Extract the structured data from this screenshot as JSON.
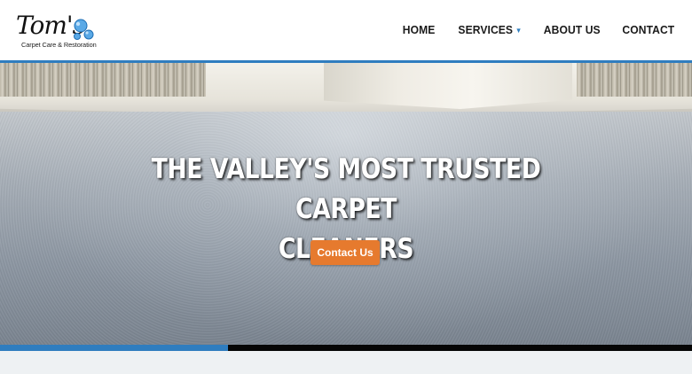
{
  "brand": {
    "logo_word": "Tom's",
    "logo_tagline": "Carpet Care & Restoration"
  },
  "nav": {
    "items": [
      {
        "label": "HOME"
      },
      {
        "label": "SERVICES",
        "has_dropdown": true
      },
      {
        "label": "ABOUT US"
      },
      {
        "label": "CONTACT"
      }
    ]
  },
  "hero": {
    "headline_line1": "THE VALLEY'S MOST TRUSTED CARPET",
    "headline_line2": "CLEANERS",
    "cta_label": "Contact Us",
    "slider_progress": 0.33
  },
  "colors": {
    "accent_blue": "#2f7dbf",
    "cta_orange": "#e67a2e",
    "nav_text": "#1a1a1a",
    "caret": "#2f7fc0"
  },
  "icons": {
    "dropdown": "chevron-down-icon",
    "logo_mark": "bubbles-icon"
  }
}
